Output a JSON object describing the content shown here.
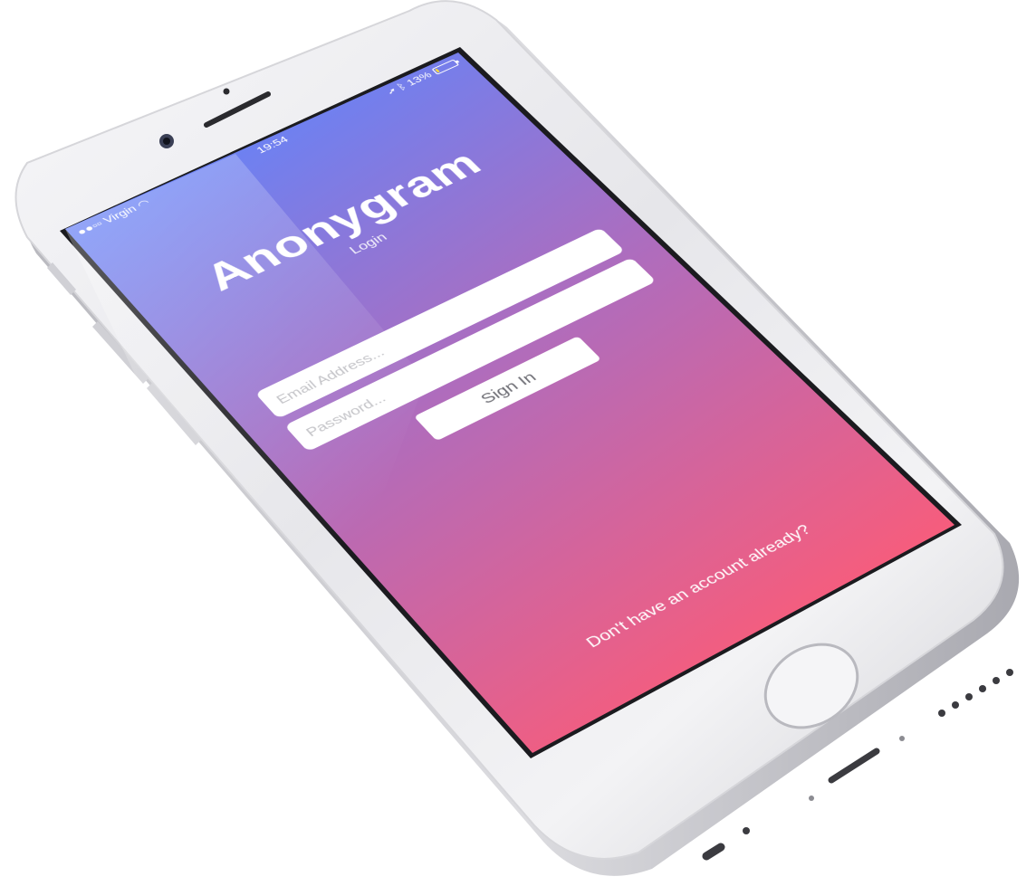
{
  "colors": {
    "gradient_top": "#6a7cf2",
    "gradient_mid": "#b06ab8",
    "gradient_bottom": "#f85a7a",
    "field_background": "#ffffff",
    "battery_level_color": "#ffdd33"
  },
  "status_bar": {
    "carrier": "Virgin",
    "signal_icon": "signal-bars-icon",
    "wifi_icon": "wifi-icon",
    "time": "19:54",
    "location_icon": "location-arrow-icon",
    "bluetooth_icon": "bluetooth-icon",
    "battery_percent": "13%",
    "battery_level": 0.13
  },
  "app": {
    "title": "Anonygram",
    "subtitle": "Login"
  },
  "form": {
    "email_placeholder": "Email Address...",
    "password_placeholder": "Password...",
    "signin_label": "Sign In"
  },
  "footer": {
    "account_link": "Don't have an account already?"
  }
}
